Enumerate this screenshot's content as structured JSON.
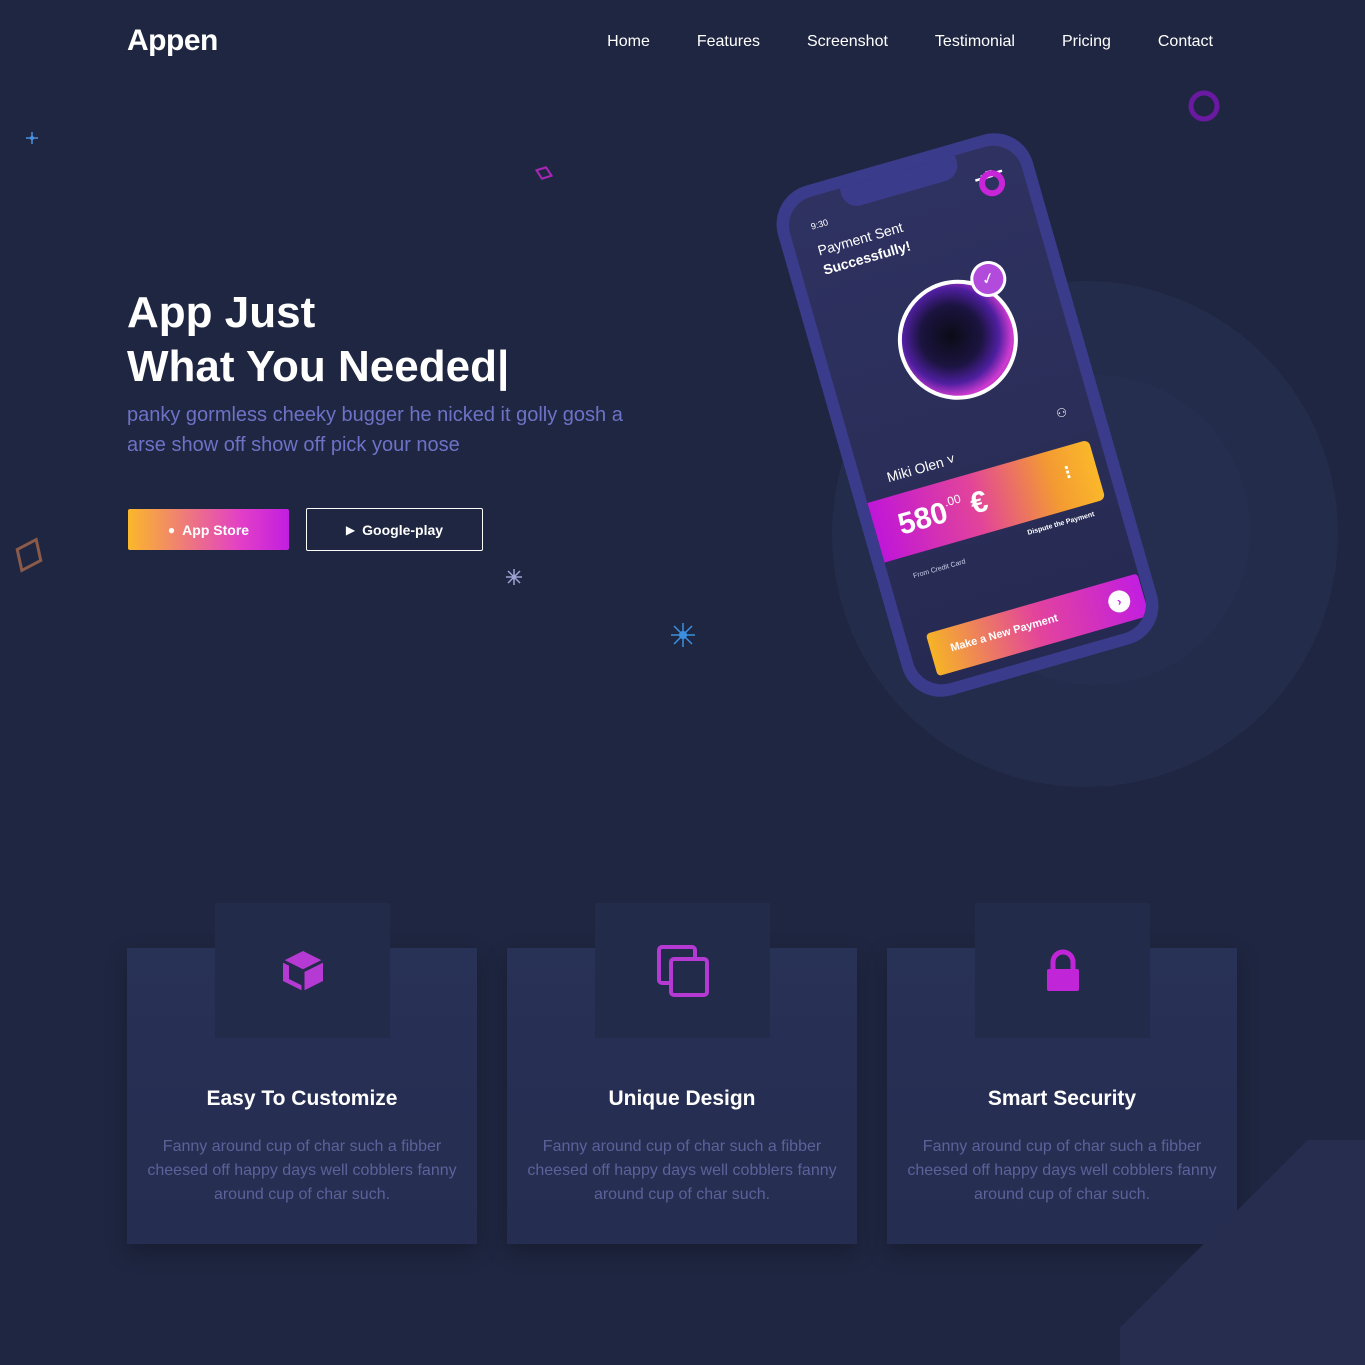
{
  "brand": "Appen",
  "nav": {
    "items": [
      "Home",
      "Features",
      "Screenshot",
      "Testimonial",
      "Pricing",
      "Contact"
    ]
  },
  "hero": {
    "title_line1": "App Just",
    "title_line2": "What You Needed|",
    "description": "panky gormless cheeky bugger he nicked it golly gosh a arse show off show off pick your nose",
    "app_store_label": "App Store",
    "google_play_label": "Google-play"
  },
  "phone": {
    "time": "9:30",
    "status_line1": "Payment Sent",
    "status_line2": "Successfully!",
    "user_name": "Miki Olen ˅",
    "amount_main": "580",
    "amount_cents": ".00",
    "currency": "€",
    "from_label": "From Credit Card",
    "dispute_label": "Dispute the Payment",
    "pay_button_label": "Make a New Payment"
  },
  "features": [
    {
      "icon": "cube-icon",
      "title": "Easy To Customize",
      "description": "Fanny around cup of char such a fibber cheesed off happy days well cobblers fanny around cup of char such."
    },
    {
      "icon": "copy-icon",
      "title": "Unique Design",
      "description": "Fanny around cup of char such a fibber cheesed off happy days well cobblers fanny around cup of char such."
    },
    {
      "icon": "lock-icon",
      "title": "Smart Security",
      "description": "Fanny around cup of char such a fibber cheesed off happy days well cobblers fanny around cup of char such."
    }
  ],
  "colors": {
    "background": "#1f2641",
    "accent_purple": "#c925d8",
    "accent_yellow": "#fbb82a",
    "muted_text": "#6d72c6"
  }
}
